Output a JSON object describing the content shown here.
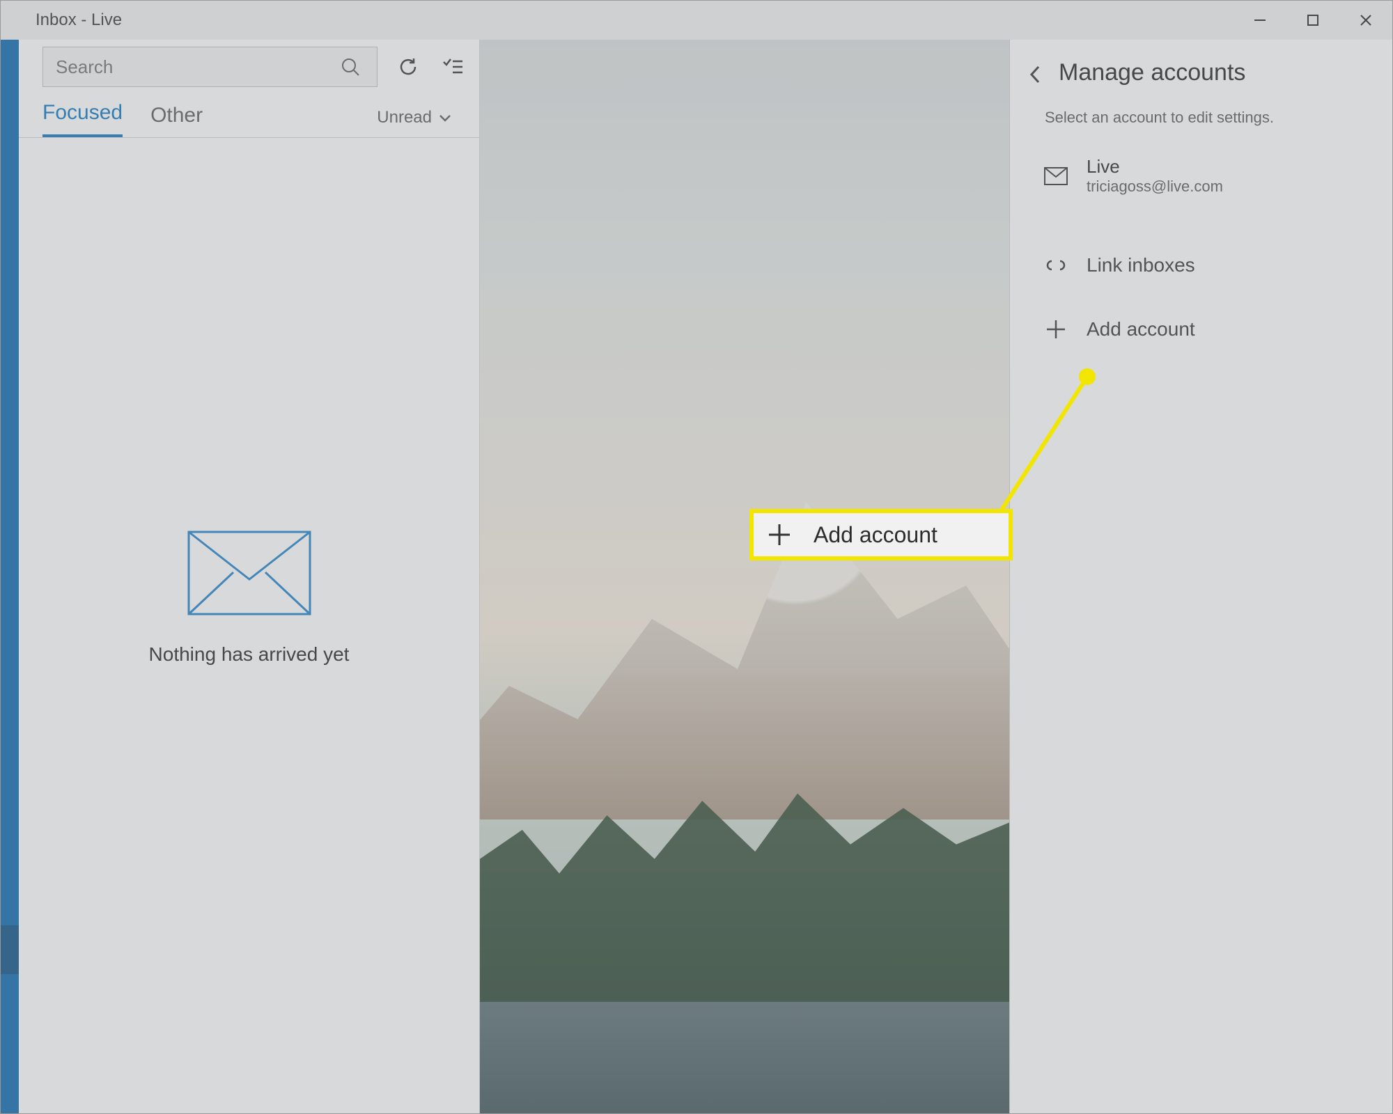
{
  "window": {
    "title": "Inbox - Live"
  },
  "toolbar": {
    "search_placeholder": "Search"
  },
  "tabs": {
    "focused": "Focused",
    "other": "Other",
    "filter_label": "Unread"
  },
  "empty": {
    "message": "Nothing has arrived yet"
  },
  "panel": {
    "title": "Manage accounts",
    "subtitle": "Select an account to edit settings.",
    "account": {
      "name": "Live",
      "email": "triciagoss@live.com"
    },
    "link_inboxes": "Link inboxes",
    "add_account": "Add account"
  },
  "callout": {
    "label": "Add account"
  }
}
